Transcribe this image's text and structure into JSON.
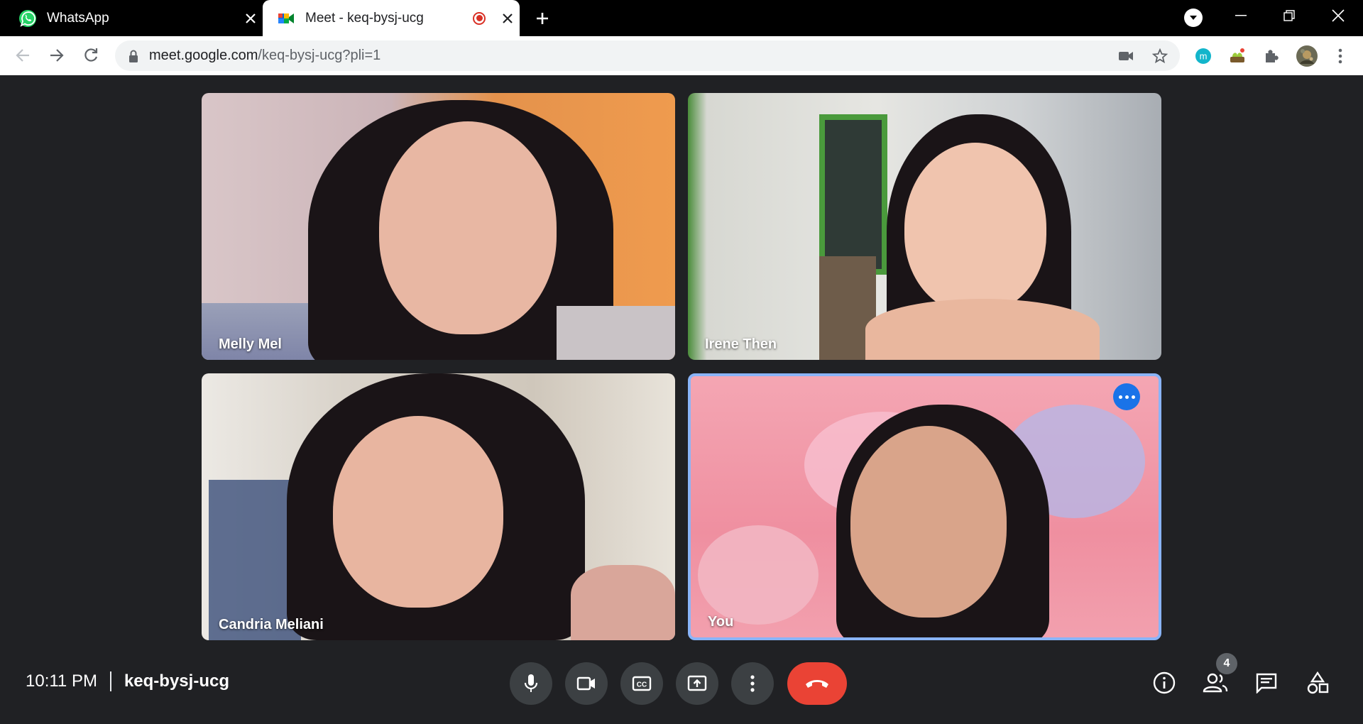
{
  "browser": {
    "tabs": [
      {
        "title": "WhatsApp",
        "icon": "whatsapp-icon"
      },
      {
        "title": "Meet - keq-bysj-ucg",
        "icon": "google-meet-icon",
        "recording": true
      }
    ],
    "url_host": "meet.google.com",
    "url_path": "/keq-bysj-ucg?pli=1",
    "extensions": [
      "m-extension-icon",
      "garden-extension-icon",
      "puzzle-icon",
      "profile-avatar"
    ]
  },
  "meet": {
    "participants": [
      {
        "name": "Melly Mel"
      },
      {
        "name": "Irene Then"
      },
      {
        "name": "Candria Meliani"
      },
      {
        "name": "You"
      }
    ],
    "time": "10:11 PM",
    "meeting_code": "keq-bysj-ucg",
    "participant_count": "4",
    "controls": [
      "microphone-icon",
      "camera-icon",
      "captions-icon",
      "present-icon",
      "more-options-icon",
      "hangup-icon"
    ],
    "side_controls": [
      "info-icon",
      "people-icon",
      "chat-icon",
      "activities-icon"
    ]
  },
  "colors": {
    "accent": "#1a73e8",
    "hangup": "#ea4335",
    "background": "#202124",
    "tile_border": "#8ab4f8"
  }
}
